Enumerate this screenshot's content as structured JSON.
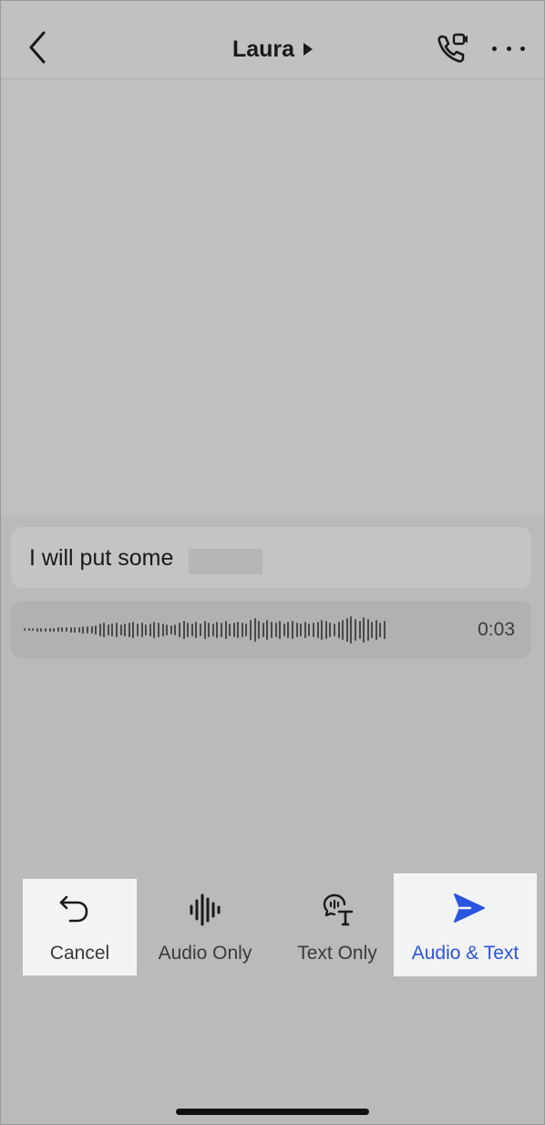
{
  "header": {
    "contact_name": "Laura",
    "icons": {
      "back": "chevron-left-icon",
      "call": "video-call-phone-icon",
      "more": "more-horizontal-icon",
      "expand": "caret-right-icon"
    }
  },
  "compose": {
    "transcribed_text": "I will put some",
    "audio_duration": "0:03"
  },
  "actions": {
    "cancel_label": "Cancel",
    "audio_only_label": "Audio Only",
    "text_only_label": "Text Only",
    "audio_text_label": "Audio & Text"
  },
  "colors": {
    "accent": "#2b55e0",
    "overlay": "#b9babb",
    "selected_bg": "#f2f3f5"
  }
}
